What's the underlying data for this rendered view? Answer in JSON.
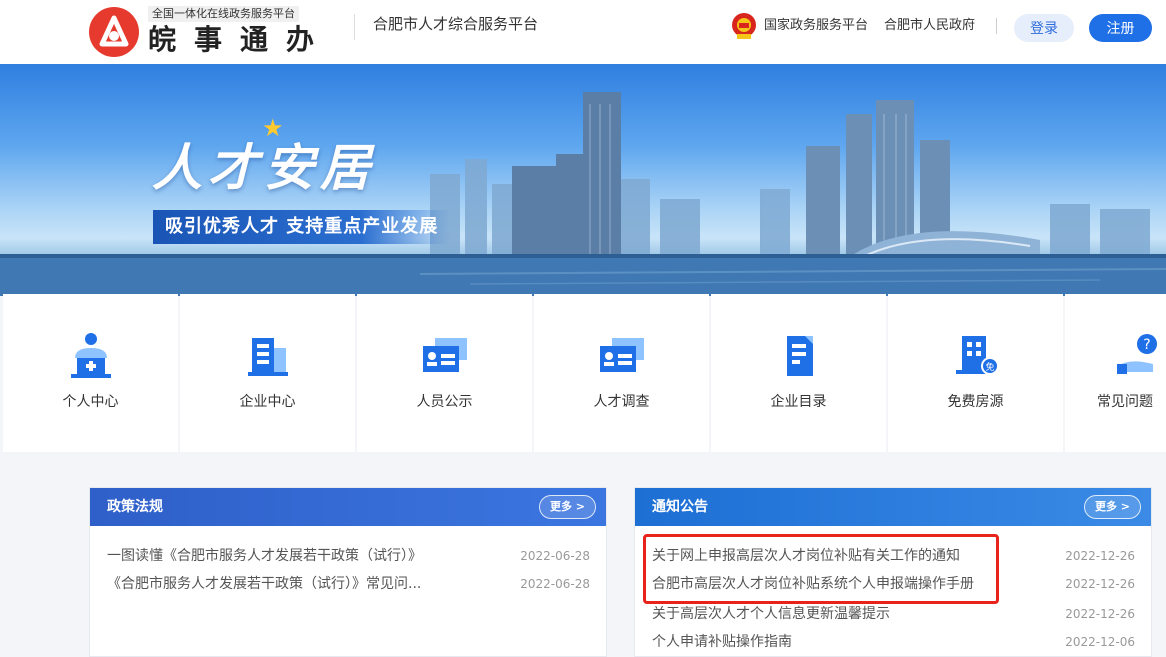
{
  "header": {
    "logo_small": "全国一体化在线政务服务平台",
    "logo_big": "皖事通办",
    "platform_title": "合肥市人才综合服务平台",
    "gov_link_1": "国家政务服务平台",
    "gov_link_2": "合肥市人民政府",
    "login_label": "登录",
    "register_label": "注册",
    "accent_color": "#1f6fe6",
    "logo_color": "#e63a2e"
  },
  "banner": {
    "title": "人才安居",
    "subtitle": "吸引优秀人才  支持重点产业发展"
  },
  "services": [
    {
      "label": "个人中心",
      "icon": "person-center-icon"
    },
    {
      "label": "企业中心",
      "icon": "enterprise-building-icon"
    },
    {
      "label": "人员公示",
      "icon": "id-card-icon"
    },
    {
      "label": "人才调查",
      "icon": "survey-card-icon"
    },
    {
      "label": "企业目录",
      "icon": "document-list-icon"
    },
    {
      "label": "免费房源",
      "icon": "free-housing-icon"
    },
    {
      "label": "常见问题",
      "icon": "faq-help-icon"
    }
  ],
  "policy": {
    "title": "政策法规",
    "more": "更多 >",
    "items": [
      {
        "title": "一图读懂《合肥市服务人才发展若干政策（试行）》",
        "date": "2022-06-28"
      },
      {
        "title": "《合肥市服务人才发展若干政策（试行）》常见问...",
        "date": "2022-06-28"
      }
    ]
  },
  "notice": {
    "title": "通知公告",
    "more": "更多 >",
    "items": [
      {
        "title": "关于网上申报高层次人才岗位补贴有关工作的通知",
        "date": "2022-12-26"
      },
      {
        "title": "合肥市高层次人才岗位补贴系统个人申报端操作手册",
        "date": "2022-12-26"
      },
      {
        "title": "关于高层次人才个人信息更新温馨提示",
        "date": "2022-12-26"
      },
      {
        "title": "个人申请补贴操作指南",
        "date": "2022-12-06"
      }
    ]
  }
}
